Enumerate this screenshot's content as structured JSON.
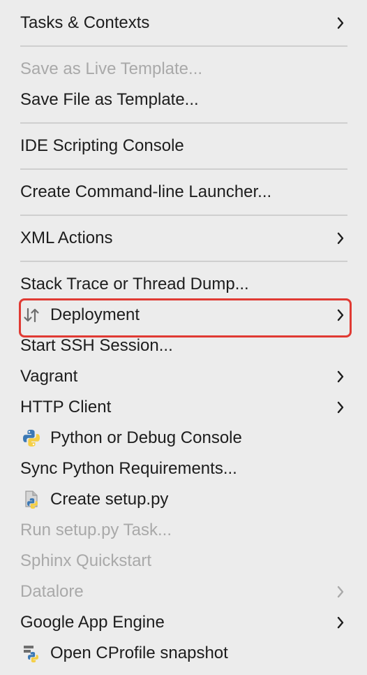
{
  "menu": {
    "items": [
      {
        "label": "Tasks & Contexts",
        "submenu": true,
        "disabled": false
      },
      {
        "label": "Save as Live Template...",
        "submenu": false,
        "disabled": true
      },
      {
        "label": "Save File as Template...",
        "submenu": false,
        "disabled": false
      },
      {
        "label": "IDE Scripting Console",
        "submenu": false,
        "disabled": false
      },
      {
        "label": "Create Command-line Launcher...",
        "submenu": false,
        "disabled": false
      },
      {
        "label": "XML Actions",
        "submenu": true,
        "disabled": false
      },
      {
        "label": "Stack Trace or Thread Dump...",
        "submenu": false,
        "disabled": false
      },
      {
        "label": "Deployment",
        "submenu": true,
        "disabled": false,
        "icon": "deployment-arrows-icon",
        "highlighted": true
      },
      {
        "label": "Start SSH Session...",
        "submenu": false,
        "disabled": false
      },
      {
        "label": "Vagrant",
        "submenu": true,
        "disabled": false
      },
      {
        "label": "HTTP Client",
        "submenu": true,
        "disabled": false
      },
      {
        "label": "Python or Debug Console",
        "submenu": false,
        "disabled": false,
        "icon": "python-icon"
      },
      {
        "label": "Sync Python Requirements...",
        "submenu": false,
        "disabled": false
      },
      {
        "label": "Create setup.py",
        "submenu": false,
        "disabled": false,
        "icon": "python-file-icon"
      },
      {
        "label": "Run setup.py Task...",
        "submenu": false,
        "disabled": true
      },
      {
        "label": "Sphinx Quickstart",
        "submenu": false,
        "disabled": true
      },
      {
        "label": "Datalore",
        "submenu": true,
        "disabled": true
      },
      {
        "label": "Google App Engine",
        "submenu": true,
        "disabled": false
      },
      {
        "label": "Open CProfile snapshot",
        "submenu": false,
        "disabled": false,
        "icon": "python-profile-icon"
      }
    ]
  },
  "colors": {
    "text": "#1d1d1d",
    "disabled_text": "#a9a9a9",
    "highlight_border": "#e03a33",
    "background": "#ececec"
  }
}
